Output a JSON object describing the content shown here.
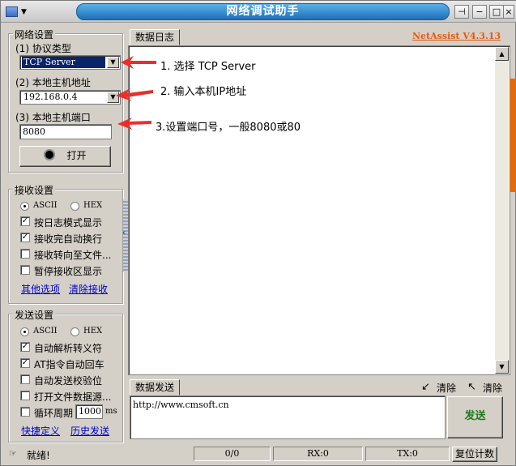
{
  "window": {
    "title": "网络调试助手",
    "version": "NetAssist V4.3.13"
  },
  "net_settings": {
    "legend": "网络设置",
    "protocol_label": "(1) 协议类型",
    "protocol_value": "TCP Server",
    "host_ip_label": "(2) 本地主机地址",
    "host_ip_value": "192.168.0.4",
    "port_label": "(3) 本地主机端口",
    "port_value": "8080",
    "open_button": "打开"
  },
  "recv_settings": {
    "legend": "接收设置",
    "radio_ascii": "ASCII",
    "radio_hex": "HEX",
    "selected": "ASCII",
    "options": [
      {
        "label": "按日志模式显示",
        "checked": true
      },
      {
        "label": "接收完自动换行",
        "checked": true
      },
      {
        "label": "接收转向至文件...",
        "checked": false
      },
      {
        "label": "暂停接收区显示",
        "checked": false
      }
    ],
    "link_more": "其他选项",
    "link_clear": "清除接收"
  },
  "send_settings": {
    "legend": "发送设置",
    "radio_ascii": "ASCII",
    "radio_hex": "HEX",
    "selected": "ASCII",
    "options": [
      {
        "label": "自动解析转义符",
        "checked": true
      },
      {
        "label": "AT指令自动回车",
        "checked": true
      },
      {
        "label": "自动发送校验位",
        "checked": false
      },
      {
        "label": "打开文件数据源...",
        "checked": false
      }
    ],
    "cycle_label": "循环周期",
    "cycle_value": "1000",
    "cycle_unit": "ms",
    "link_shortcut": "快捷定义",
    "link_history": "历史发送"
  },
  "log": {
    "tab": "数据日志"
  },
  "annotations": [
    "1. 选择 TCP Server",
    "2. 输入本机IP地址",
    "3.设置端口号，一般8080或80"
  ],
  "send": {
    "tab": "数据发送",
    "clear1": "清除",
    "clear2": "清除",
    "text": "http://www.cmsoft.cn",
    "button": "发送"
  },
  "status": {
    "text": "就绪!",
    "count": "0/0",
    "rx": "RX:0",
    "tx": "TX:0",
    "reset": "复位计数"
  },
  "colors": {
    "accent": "#e85a10",
    "arrow": "#e8302a",
    "title_bg": "#1e6fb8",
    "send_green": "#1a7a1a"
  }
}
